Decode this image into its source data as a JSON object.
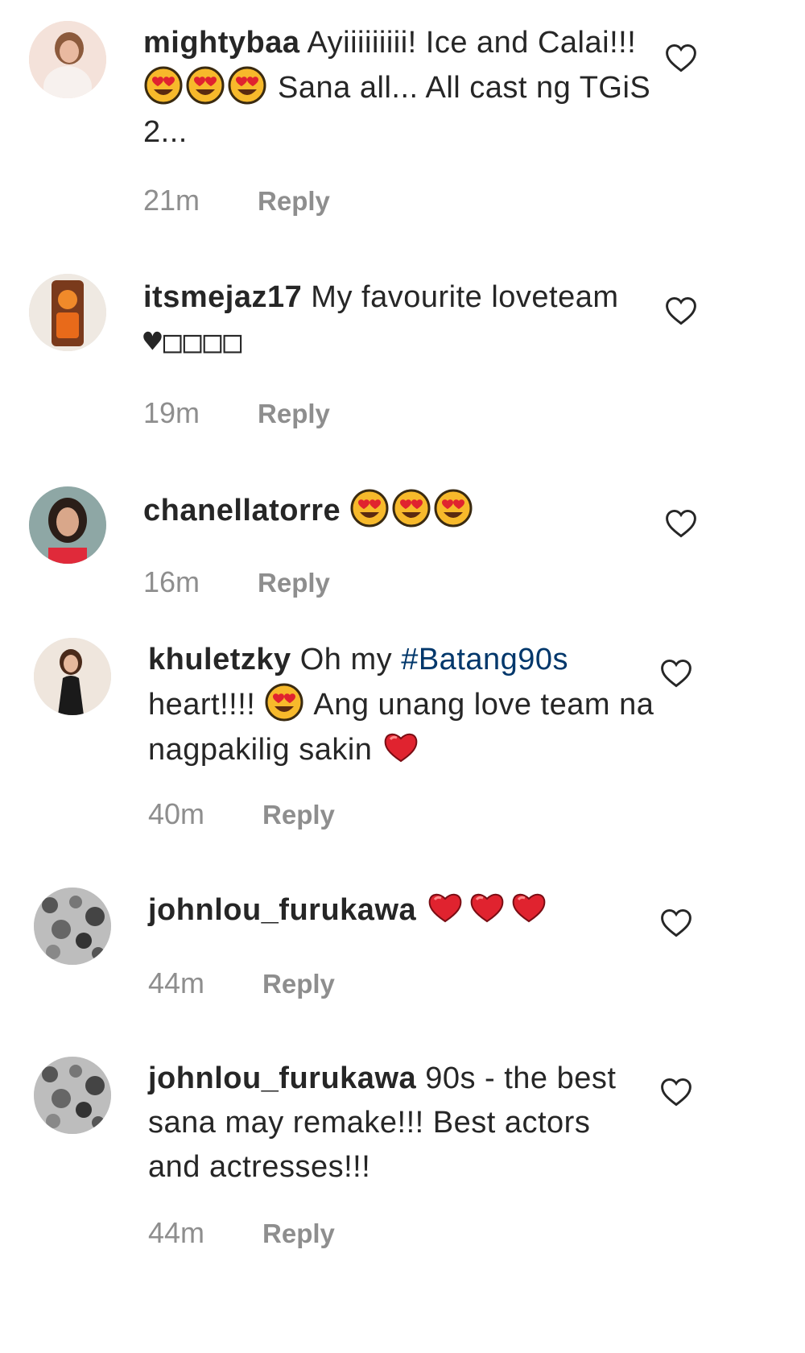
{
  "comments": [
    {
      "username": "mightybaa",
      "segments": [
        "Ayiiiiiiiii! Ice and Calai!!!",
        " Sana all... All cast ng TGiS 2..."
      ],
      "emojis": [
        "heart-eyes-emoji",
        "heart-eyes-emoji",
        "heart-eyes-emoji"
      ],
      "time": "21m",
      "reply": "Reply"
    },
    {
      "username": "itsmejaz17",
      "text": "My favourite loveteam",
      "trailing": "♥□□□□",
      "time": "19m",
      "reply": "Reply"
    },
    {
      "username": "chanellatorre",
      "emojis": [
        "heart-eyes-emoji",
        "heart-eyes-emoji",
        "heart-eyes-emoji"
      ],
      "time": "16m",
      "reply": "Reply"
    },
    {
      "username": "khuletzky",
      "text_before": "Oh my",
      "hashtag": "#Batang90s",
      "text_mid": "heart!!!!",
      "text_after": "Ang unang love team na nagpakilig sakin",
      "time": "40m",
      "reply": "Reply"
    },
    {
      "username": "johnlou_furukawa",
      "emojis": [
        "red-heart-emoji",
        "red-heart-emoji",
        "red-heart-emoji"
      ],
      "time": "44m",
      "reply": "Reply"
    },
    {
      "username": "johnlou_furukawa",
      "text": "90s - the best sana may remake!!! Best actors and actresses!!!",
      "time": "44m",
      "reply": "Reply"
    }
  ],
  "colors": {
    "text": "#262626",
    "meta": "#8e8e8e",
    "hashtag": "#00376b",
    "emoji_face": "#f5b324",
    "emoji_heart": "#e0232f"
  },
  "icons": {
    "like": "heart-outline-icon"
  }
}
